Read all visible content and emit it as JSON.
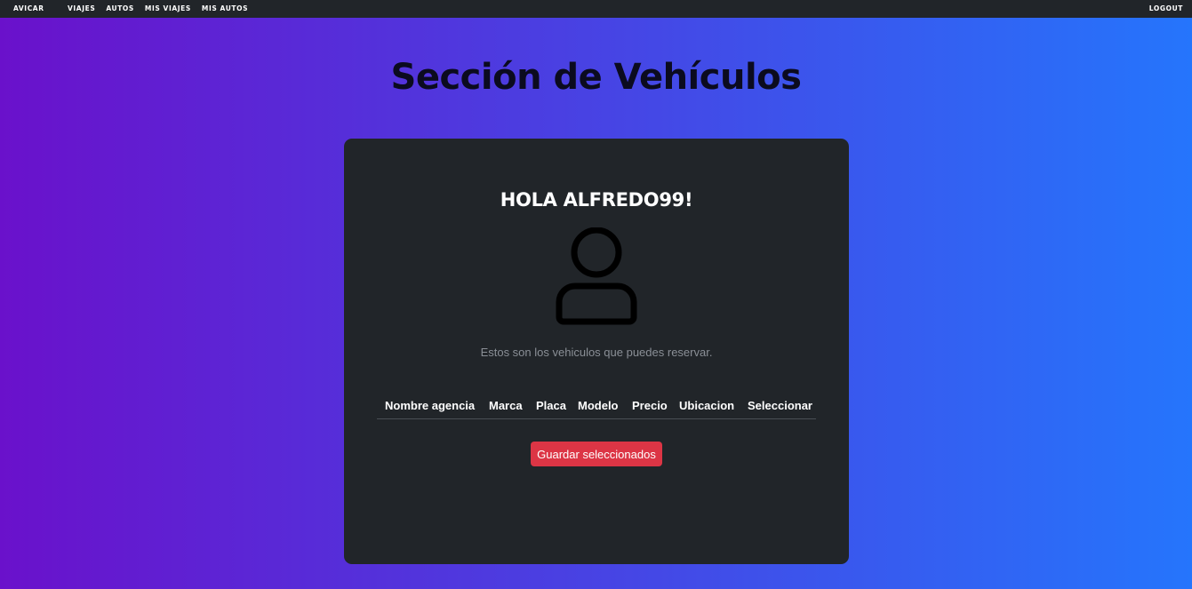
{
  "navbar": {
    "brand": "AVICAR",
    "links": [
      "VIAJES",
      "AUTOS",
      "MIS VIAJES",
      "MIS AUTOS"
    ],
    "logout": "LOGOUT"
  },
  "page": {
    "title": "Sección de Vehículos"
  },
  "card": {
    "greeting": "HOLA ALFREDO99!",
    "avatar_icon": "user-icon",
    "subtitle": "Estos son los vehiculos que puedes reservar.",
    "table": {
      "columns": [
        "Nombre agencia",
        "Marca",
        "Placa",
        "Modelo",
        "Precio",
        "Ubicacion",
        "Seleccionar"
      ],
      "rows": []
    },
    "save_button": "Guardar seleccionados"
  },
  "colors": {
    "gradient_start": "#6a11cb",
    "gradient_end": "#2575fc",
    "card_bg": "#212529",
    "save_button": "#dc3545"
  }
}
